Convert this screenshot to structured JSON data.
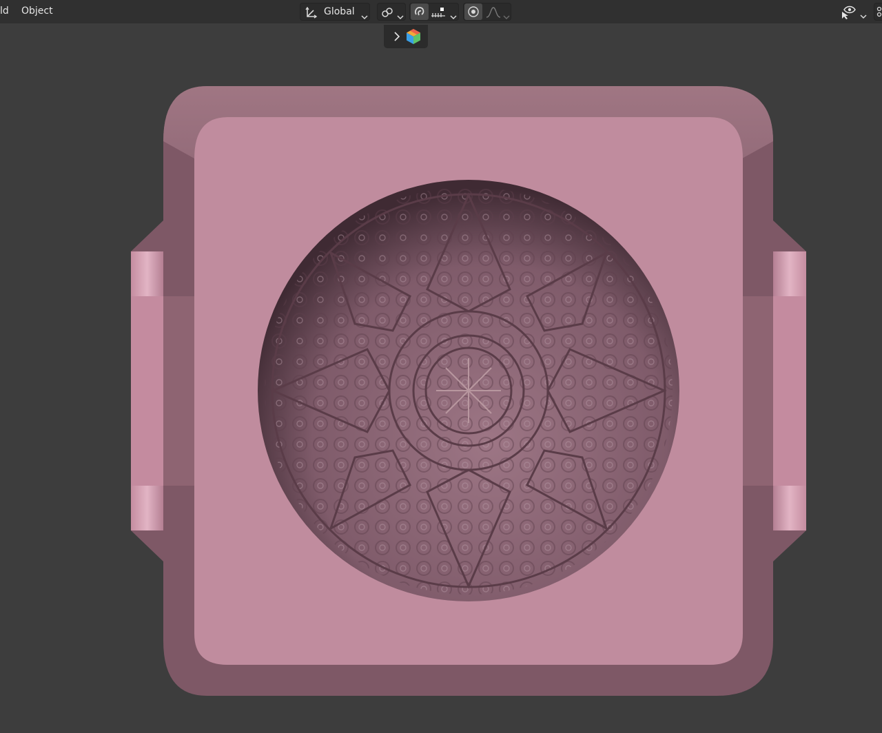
{
  "header": {
    "menu_partial": "ld",
    "menu_object": "Object"
  },
  "toolbar": {
    "orientation_label": "Global",
    "orientation_icon": "transform-orientation-icon",
    "pivot_icon": "pivot-point-icon",
    "snap_icon": "snap-magnet-icon",
    "snap_target_icon": "snap-increment-icon",
    "proportional_icon": "proportional-editing-icon",
    "falloff_icon": "falloff-curve-icon",
    "visibility_icon": "eye-icon"
  },
  "gizmo": {
    "expand_icon": "chevron-right-icon",
    "object_gizmo_icon": "color-cube-icon"
  },
  "colors": {
    "viewport_bg": "#3d3d3d",
    "header_bg": "#303030",
    "mesh_face": "#c08c9e",
    "mesh_shadow": "#7d5866"
  }
}
